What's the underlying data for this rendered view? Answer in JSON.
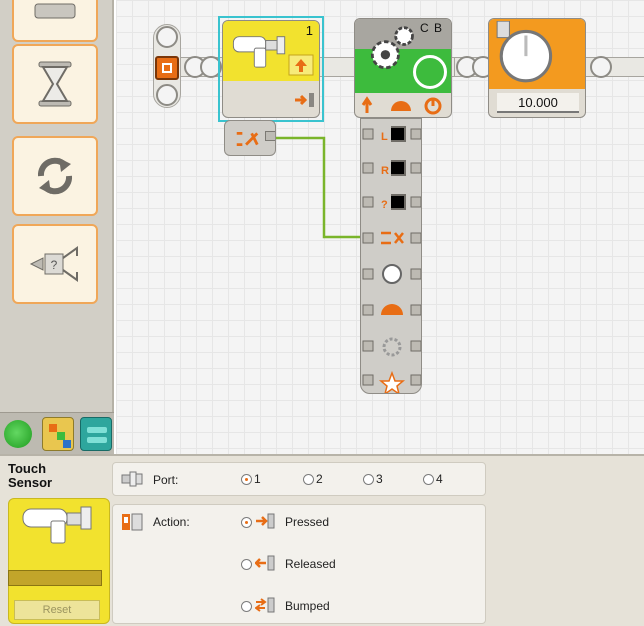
{
  "config_panel": {
    "title_line1": "Touch",
    "title_line2": "Sensor",
    "reset_label": "Reset",
    "port": {
      "label": "Port:",
      "options": [
        "1",
        "2",
        "3",
        "4"
      ],
      "selected": "1"
    },
    "action": {
      "label": "Action:",
      "options": [
        "Pressed",
        "Released",
        "Bumped"
      ],
      "selected": "Pressed"
    }
  },
  "canvas": {
    "touch_block": {
      "port": "1"
    },
    "motor_block": {
      "ports": "C B"
    },
    "wait_block": {
      "value": "10.000"
    }
  },
  "colors": {
    "sensor_yellow": "#f2e22e",
    "motor_green": "#3dbb3d",
    "timer_orange": "#f39a1f",
    "selection_cyan": "#39c3cf",
    "wire_green": "#7ab52a",
    "accent_orange": "#e86d15"
  },
  "icons": {
    "palette": [
      "move-icon",
      "hourglass-icon",
      "loop-icon",
      "switch-icon"
    ],
    "palette_tabs": [
      "common-palette-icon",
      "complete-palette-icon",
      "custom-palette-icon"
    ],
    "motor_hub": [
      "left-motor-icon",
      "right-motor-icon",
      "third-motor-icon",
      "logic-icon",
      "direction-icon",
      "power-icon",
      "duration-icon",
      "action-icon"
    ]
  }
}
